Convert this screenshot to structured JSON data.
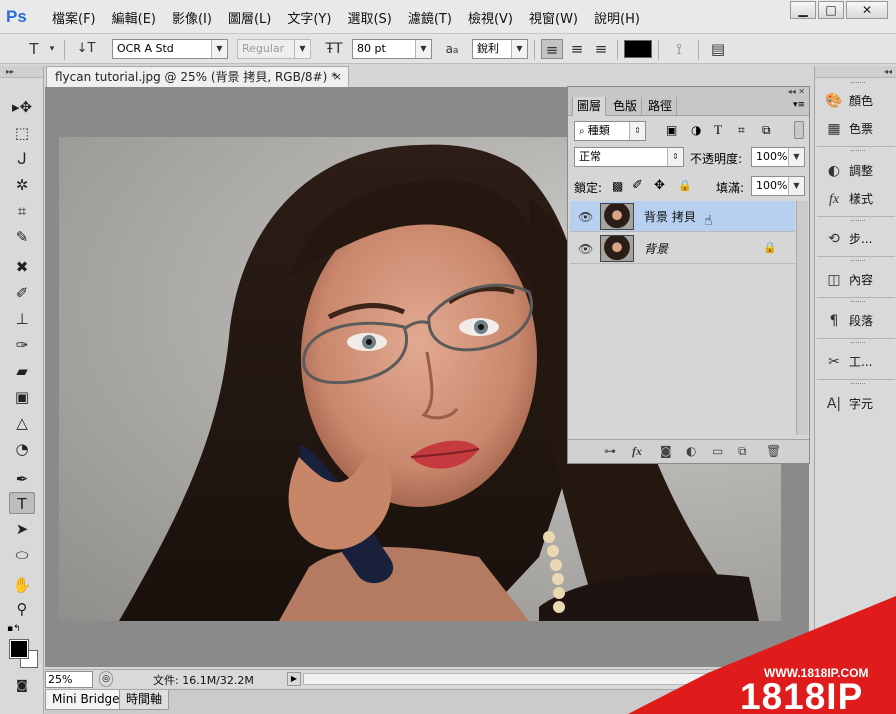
{
  "app": {
    "logo": "Ps"
  },
  "menu": [
    "檔案(F)",
    "編輯(E)",
    "影像(I)",
    "圖層(L)",
    "文字(Y)",
    "選取(S)",
    "濾鏡(T)",
    "檢視(V)",
    "視窗(W)",
    "說明(H)"
  ],
  "window_buttons": {
    "minimize": "▁",
    "maximize": "□",
    "close": "✕"
  },
  "options": {
    "tool_glyph": "T",
    "font_family": "OCR A Std",
    "font_style": "Regular",
    "font_size": "80 pt",
    "aa_label": "a",
    "antialias": "銳利"
  },
  "document": {
    "tab_title": "flycan tutorial.jpg @ 25% (背景 拷貝, RGB/8#) *",
    "close": "×",
    "zoom": "25%",
    "doc_info": "文件: 16.1M/32.2M"
  },
  "bottom_tabs": [
    "Mini Bridge",
    "時間軸"
  ],
  "layers_panel": {
    "tabs": [
      "圖層",
      "色版",
      "路徑"
    ],
    "filter_kind": "種類",
    "blend_mode": "正常",
    "opacity_label": "不透明度:",
    "opacity": "100%",
    "lock_label": "鎖定:",
    "fill_label": "填滿:",
    "fill": "100%",
    "layers": [
      {
        "name": "背景 拷貝",
        "selected": true,
        "locked": false
      },
      {
        "name": "背景",
        "selected": false,
        "locked": true
      }
    ],
    "bottom_icons": [
      "link-icon",
      "fx-icon",
      "mask-icon",
      "adjustment-icon",
      "folder-icon",
      "new-layer-icon",
      "trash-icon"
    ],
    "fx_label": "fx"
  },
  "dock": [
    {
      "icon": "color-icon",
      "label": "顏色"
    },
    {
      "icon": "swatches-icon",
      "label": "色票"
    },
    {
      "icon": "adjustments-icon",
      "label": "調整"
    },
    {
      "icon": "styles-icon",
      "label": "樣式"
    },
    {
      "icon": "history-icon",
      "label": "步..."
    },
    {
      "icon": "content-icon",
      "label": "內容"
    },
    {
      "icon": "paragraph-icon",
      "label": "段落"
    },
    {
      "icon": "tool-presets-icon",
      "label": "工..."
    },
    {
      "icon": "character-icon",
      "label": "字元"
    }
  ],
  "watermark": {
    "url": "WWW.1818IP.COM",
    "brand": "1818IP"
  }
}
